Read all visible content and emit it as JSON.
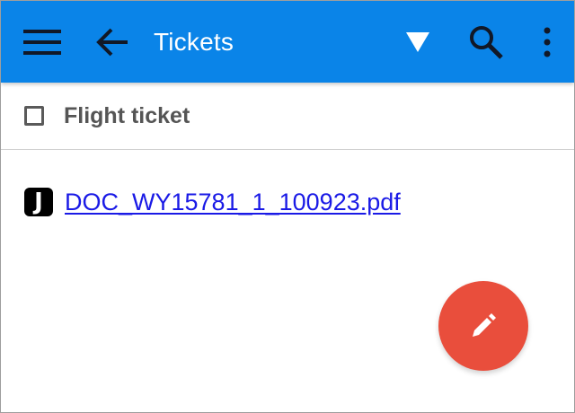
{
  "appbar": {
    "title": "Tickets",
    "background_color": "#0a84e8",
    "icons": {
      "menu": "menu-icon",
      "back": "arrow-back-icon",
      "dropdown": "triangle-down-icon",
      "search": "search-icon",
      "more": "more-vert-icon"
    }
  },
  "section": {
    "title": "Flight ticket",
    "checked": false
  },
  "attachments": [
    {
      "badge": "J",
      "filename": "DOC_WY15781_1_100923.pdf"
    }
  ],
  "fab": {
    "icon": "pencil-icon",
    "color": "#e94e3c"
  }
}
